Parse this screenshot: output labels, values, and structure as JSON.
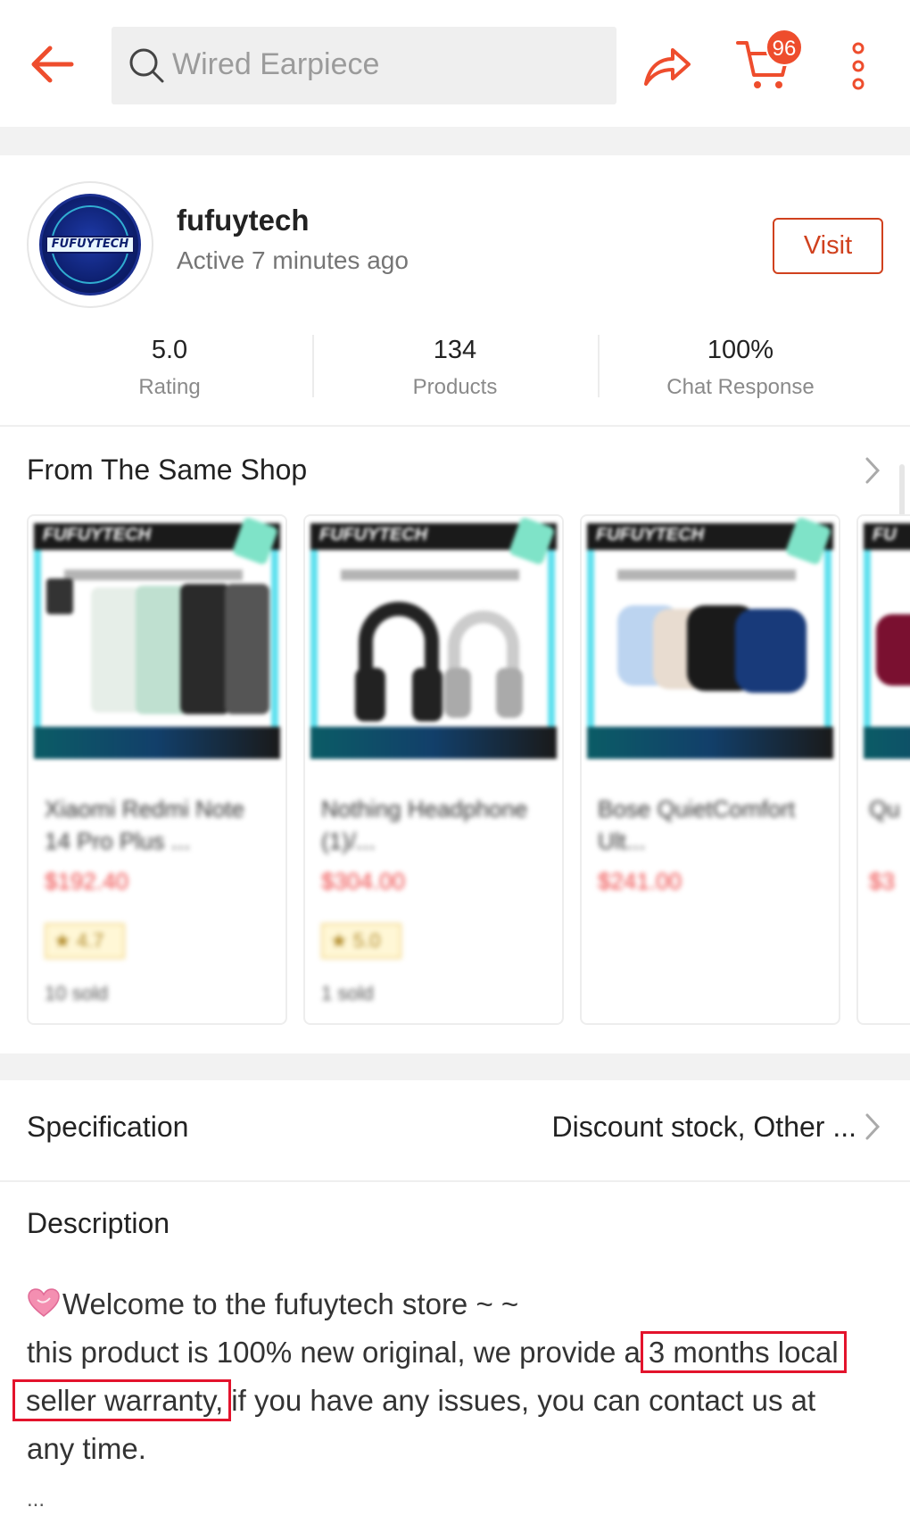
{
  "header": {
    "search_placeholder": "Wired Earpiece",
    "cart_count": "96",
    "icons": [
      "back-arrow-icon",
      "search-icon",
      "share-icon",
      "cart-icon",
      "more-vertical-icon"
    ],
    "accent_color": "#ee4d2d"
  },
  "shop": {
    "name": "fufuytech",
    "active_status": "Active 7 minutes ago",
    "visit_label": "Visit",
    "avatar_text": "FUFUYTECH",
    "stats": [
      {
        "value": "5.0",
        "label": "Rating"
      },
      {
        "value": "134",
        "label": "Products"
      },
      {
        "value": "100%",
        "label": "Chat Response"
      }
    ]
  },
  "same_shop": {
    "title": "From The Same Shop",
    "products": [
      {
        "banner": "FUFUYTECH",
        "name": "Xiaomi Redmi Note 14 Pro Plus ...",
        "price": "$192.40",
        "rating": "4.7",
        "sold": "10 sold"
      },
      {
        "banner": "FUFUYTECH",
        "name": "Nothing Headphone (1)/...",
        "price": "$304.00",
        "rating": "5.0",
        "sold": "1 sold"
      },
      {
        "banner": "FUFUYTECH",
        "name": "Bose QuietComfort Ult...",
        "price": "$241.00",
        "rating": "",
        "sold": ""
      },
      {
        "banner": "FU",
        "name": "Qu",
        "price": "$3",
        "rating": "",
        "sold": ""
      }
    ]
  },
  "specification": {
    "label": "Specification",
    "value": "Discount stock, Other ..."
  },
  "description": {
    "title": "Description",
    "line1": "Welcome to the fufuytech store ~ ~",
    "line2_a": "this product is 100% new original, we provide a",
    "line2_highlight": "3 months local",
    "line3_highlight": "seller warranty,",
    "line3_b": "if you have any issues, you can contact us at",
    "line4": "any time.",
    "ellipsis": "..."
  }
}
